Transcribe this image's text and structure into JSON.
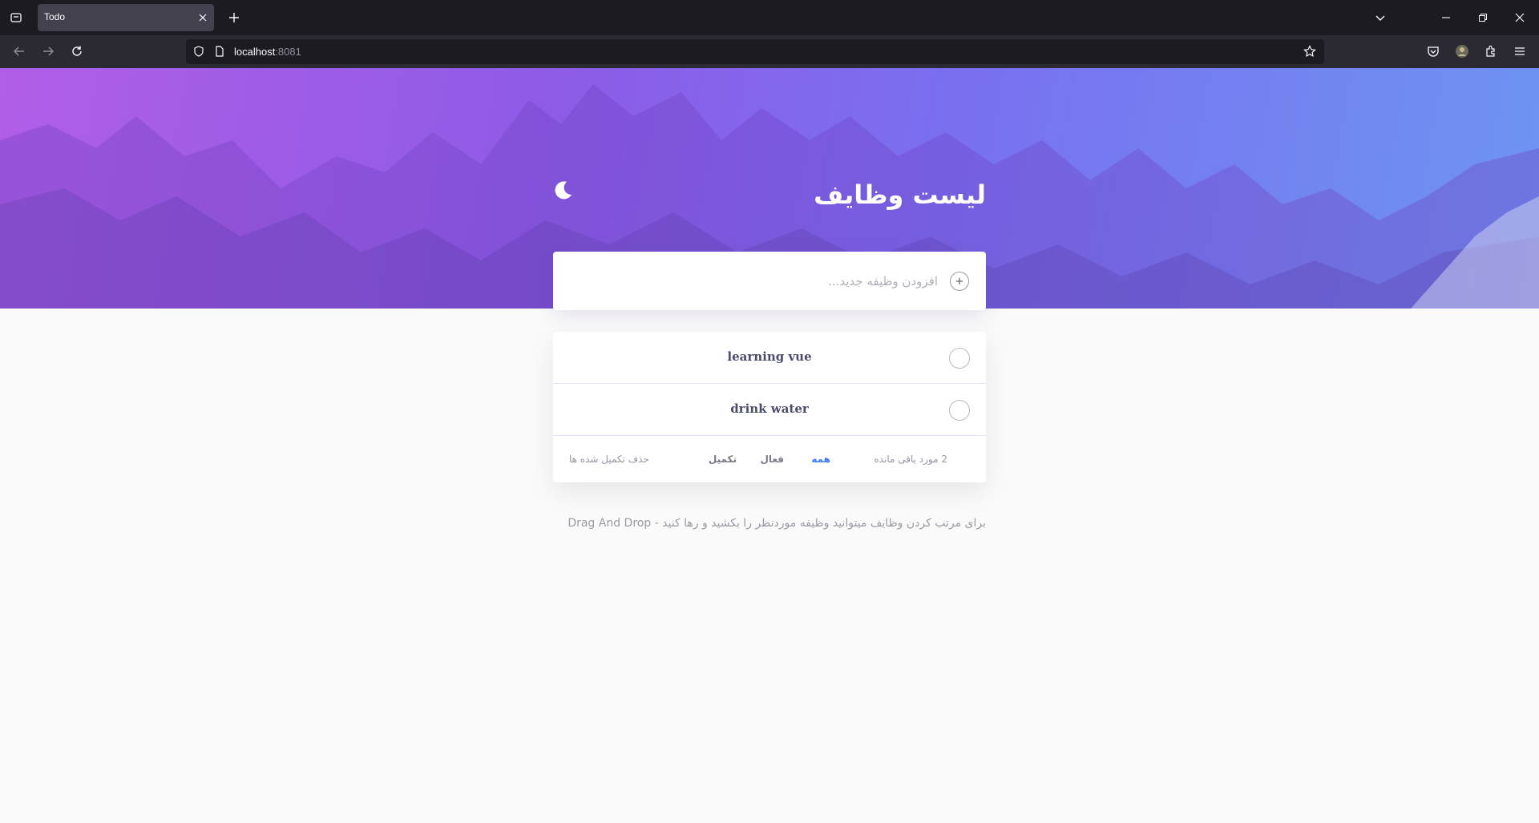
{
  "browser": {
    "tab_title": "Todo",
    "url_host": "localhost",
    "url_port": ":8081"
  },
  "app": {
    "title": "لیست وظایف",
    "new_todo_placeholder": "افزودن وظیفه جدید...",
    "add_symbol": "+",
    "todos": [
      {
        "text": "learning vue",
        "completed": false
      },
      {
        "text": "drink water",
        "completed": false
      }
    ],
    "footer": {
      "items_left": "2 مورد باقی مانده",
      "filter_all": "همه",
      "filter_active": "فعال",
      "filter_completed": "تکمیل",
      "clear_completed": "حذف تکمیل شده ها",
      "active_filter": "all"
    },
    "hint": "برای مرتب کردن وظایف میتوانید وظیفه موردنظر را بکشید و رها کنید - Drag And Drop"
  },
  "colors": {
    "accent": "#3a7cfd",
    "hero_start": "#b15ee8",
    "hero_end": "#6d95f2"
  }
}
